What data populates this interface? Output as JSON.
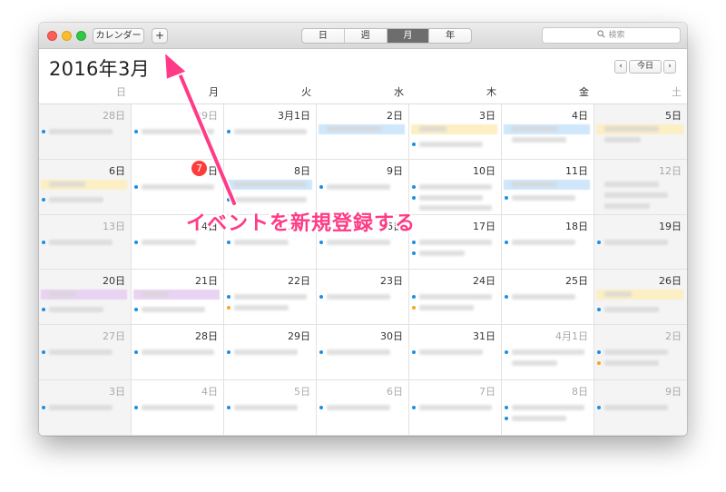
{
  "toolbar": {
    "calendars_label": "カレンダー",
    "add_label": "+",
    "views": [
      {
        "label": "日",
        "active": false
      },
      {
        "label": "週",
        "active": false
      },
      {
        "label": "月",
        "active": true
      },
      {
        "label": "年",
        "active": false
      }
    ],
    "search_placeholder": "検索",
    "search_icon": "magnifier-icon"
  },
  "header": {
    "month_title": "2016年3月",
    "prev_label": "‹",
    "today_label": "今日",
    "next_label": "›"
  },
  "weekdays": [
    "日",
    "月",
    "火",
    "水",
    "木",
    "金",
    "土"
  ],
  "weeks": [
    [
      "28日",
      "29日",
      "3月1日",
      "2日",
      "3日",
      "4日",
      "5日"
    ],
    [
      "6日",
      "7",
      "8日",
      "9日",
      "10日",
      "11日",
      "12日"
    ],
    [
      "13日",
      "14日",
      "15日",
      "16日",
      "17日",
      "18日",
      "19日"
    ],
    [
      "20日",
      "21日",
      "22日",
      "23日",
      "24日",
      "25日",
      "26日"
    ],
    [
      "27日",
      "28日",
      "29日",
      "30日",
      "31日",
      "4月1日",
      "2日"
    ],
    [
      "3日",
      "4日",
      "5日",
      "6日",
      "7日",
      "8日",
      "9日"
    ]
  ],
  "annotation": "イベントを新規登録する",
  "colors": {
    "accent_pink": "#ff3a86",
    "today_red": "#fc3d39",
    "event_blue": "#1a8fe6",
    "event_yellow": "#fcefc4",
    "event_lightblue": "#cfe6fb",
    "event_purple": "#e9d3f3"
  }
}
